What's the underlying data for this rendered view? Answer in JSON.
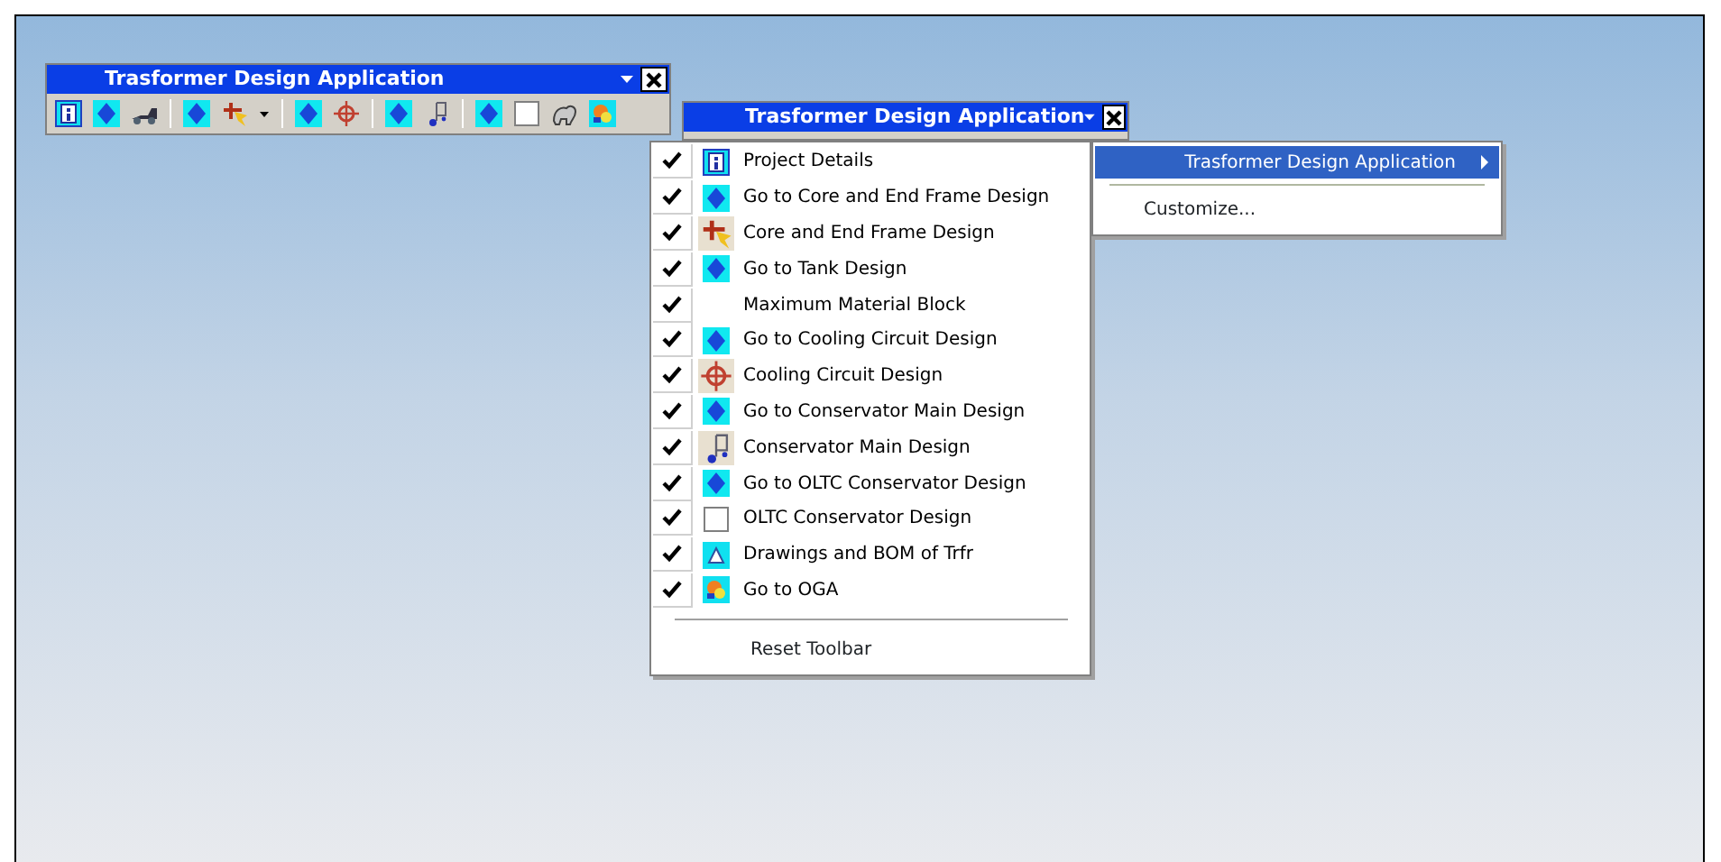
{
  "toolbar": {
    "title": "Trasformer Design Application",
    "buttons": [
      {
        "kind": "info"
      },
      {
        "kind": "diamond"
      },
      {
        "kind": "truck"
      },
      {
        "kind": "separator"
      },
      {
        "kind": "diamond"
      },
      {
        "kind": "core"
      },
      {
        "kind": "caret"
      },
      {
        "kind": "separator"
      },
      {
        "kind": "diamond"
      },
      {
        "kind": "crosshair"
      },
      {
        "kind": "separator"
      },
      {
        "kind": "diamond"
      },
      {
        "kind": "note"
      },
      {
        "kind": "separator"
      },
      {
        "kind": "diamond"
      },
      {
        "kind": "blank"
      },
      {
        "kind": "animal"
      },
      {
        "kind": "oga"
      }
    ]
  },
  "floating_toolbar": {
    "title": "Trasformer Design Application"
  },
  "menu": {
    "items": [
      {
        "label": "Project Details",
        "checked": true,
        "kind": "info"
      },
      {
        "label": "Go to Core and End Frame Design",
        "checked": true,
        "kind": "diamond"
      },
      {
        "label": "Core and End Frame Design",
        "checked": true,
        "kind": "core"
      },
      {
        "label": "Go to Tank Design",
        "checked": true,
        "kind": "diamond"
      },
      {
        "label": "Maximum Material Block",
        "checked": true,
        "kind": "none"
      },
      {
        "label": "Go to Cooling Circuit Design",
        "checked": true,
        "kind": "diamond"
      },
      {
        "label": "Cooling Circuit Design",
        "checked": true,
        "kind": "crosshair"
      },
      {
        "label": "Go to Conservator Main Design",
        "checked": true,
        "kind": "diamond"
      },
      {
        "label": "Conservator Main Design",
        "checked": true,
        "kind": "note"
      },
      {
        "label": "Go to OLTC Conservator Design",
        "checked": true,
        "kind": "diamond"
      },
      {
        "label": "OLTC Conservator Design",
        "checked": true,
        "kind": "blank"
      },
      {
        "label": "Drawings and BOM of Trfr",
        "checked": true,
        "kind": "drawing"
      },
      {
        "label": "Go to OGA",
        "checked": true,
        "kind": "oga"
      }
    ],
    "footer": "Reset Toolbar"
  },
  "submenu": {
    "items": [
      {
        "label": "Trasformer Design Application",
        "selected": true
      },
      {
        "label": "Customize...",
        "selected": false
      }
    ]
  }
}
